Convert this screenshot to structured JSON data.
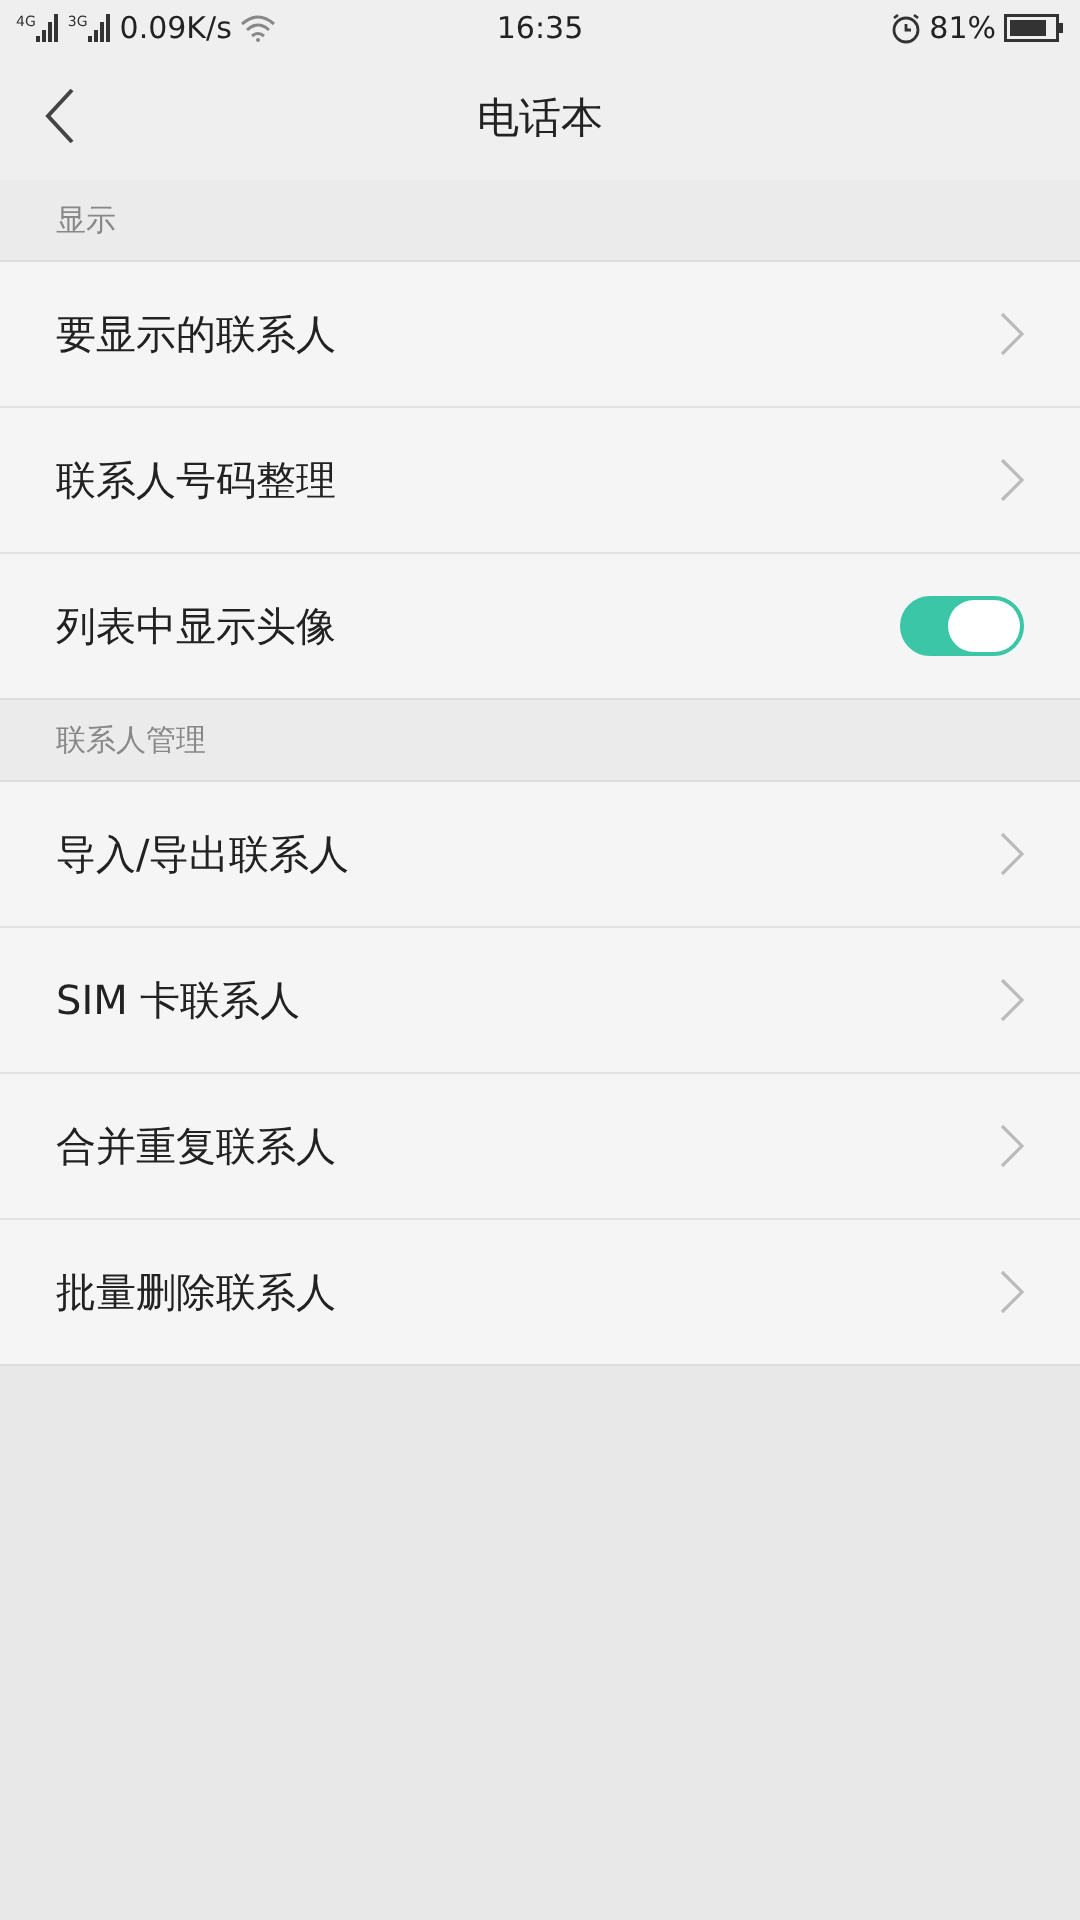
{
  "status_bar": {
    "signals": [
      "4G",
      "3G"
    ],
    "speed": "0.09K/s",
    "time": "16:35",
    "battery": "81%"
  },
  "header": {
    "title": "电话本"
  },
  "sections": [
    {
      "title": "显示",
      "items": [
        {
          "kind": "link",
          "label": "要显示的联系人"
        },
        {
          "kind": "link",
          "label": "联系人号码整理"
        },
        {
          "kind": "toggle",
          "label": "列表中显示头像",
          "on": true
        }
      ]
    },
    {
      "title": "联系人管理",
      "items": [
        {
          "kind": "link",
          "label": "导入/导出联系人"
        },
        {
          "kind": "link",
          "label": "SIM 卡联系人"
        },
        {
          "kind": "link",
          "label": "合并重复联系人"
        },
        {
          "kind": "link",
          "label": "批量删除联系人"
        }
      ]
    }
  ]
}
